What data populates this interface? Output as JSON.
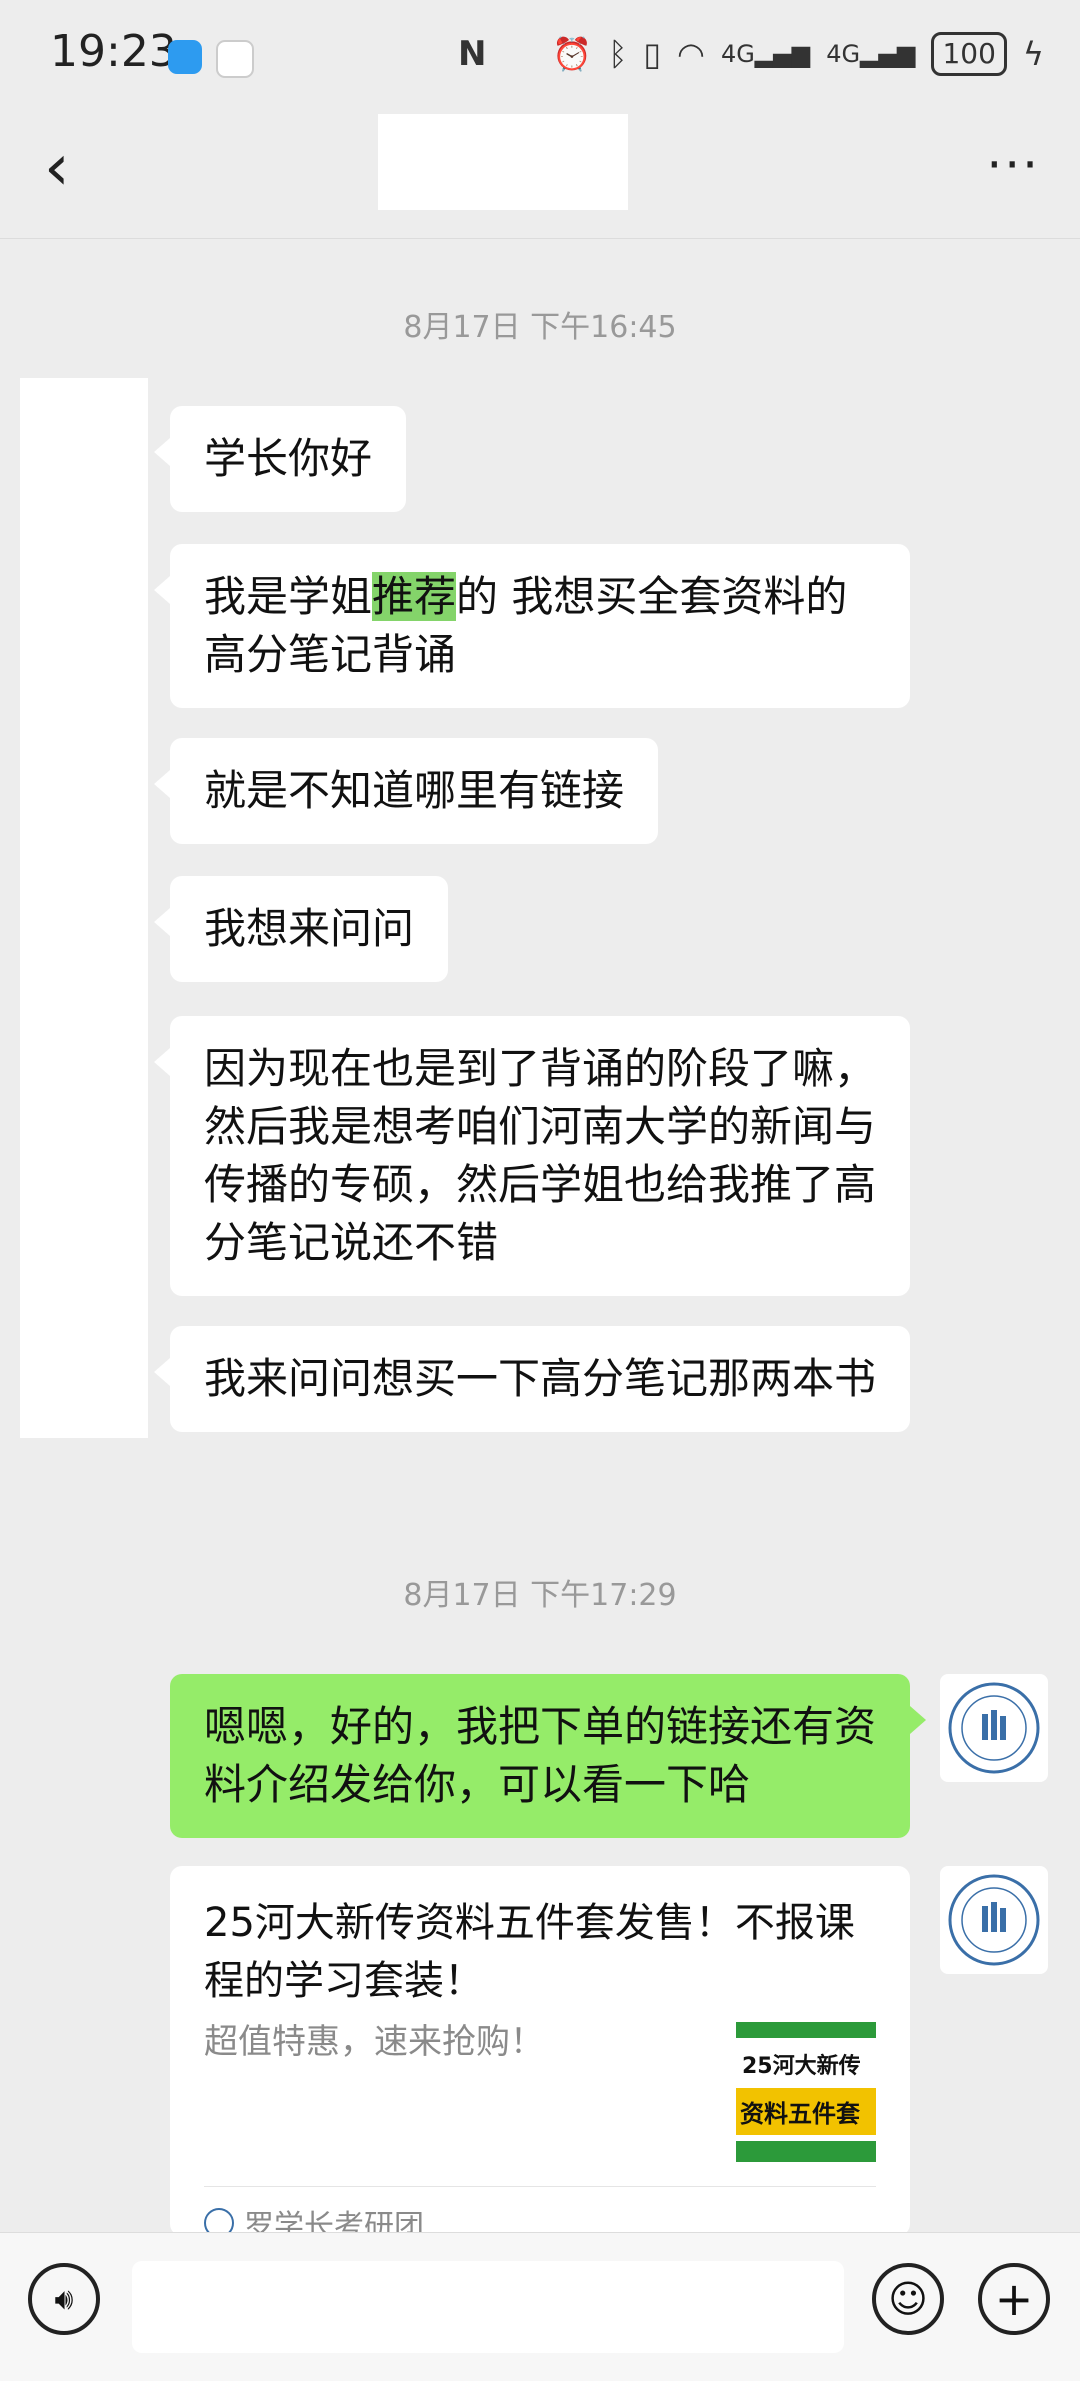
{
  "status": {
    "time": "19:23",
    "battery": "100"
  },
  "chat": {
    "timestamps": [
      "8月17日 下午16:45",
      "8月17日 下午17:29"
    ],
    "messages": [
      {
        "side": "left",
        "text": "学长你好"
      },
      {
        "side": "left",
        "before": "我是学姐",
        "highlight": "推荐",
        "after": "的 我想买全套资料的高分笔记背诵"
      },
      {
        "side": "left",
        "text": "就是不知道哪里有链接"
      },
      {
        "side": "left",
        "text": "我想来问问"
      },
      {
        "side": "left",
        "text": "因为现在也是到了背诵的阶段了嘛，然后我是想考咱们河南大学的新闻与传播的专硕，然后学姐也给我推了高分笔记说还不错"
      },
      {
        "side": "left",
        "text": "我来问问想买一下高分笔记那两本书"
      },
      {
        "side": "right",
        "text": "嗯嗯，好的，我把下单的链接还有资料介绍发给你，可以看一下哈"
      }
    ],
    "card": {
      "title": "25河大新传资料五件套发售！不报课程的学习套装！",
      "desc": "超值特惠，速来抢购！",
      "thumb_line1": "25河大新传",
      "thumb_line2": "资料五件套",
      "source": "罗学长考研团"
    }
  },
  "colors": {
    "bg": "#ededed",
    "sent_bubble": "#95ec69",
    "highlight": "#84d46a"
  }
}
